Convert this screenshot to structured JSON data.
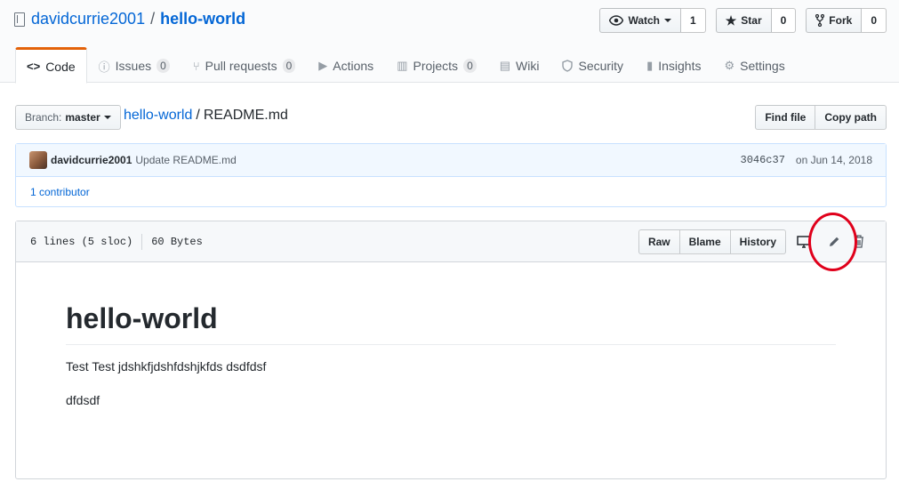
{
  "repo": {
    "owner": "davidcurrie2001",
    "name": "hello-world"
  },
  "actions": {
    "watch": {
      "label": "Watch",
      "count": "1"
    },
    "star": {
      "label": "Star",
      "count": "0"
    },
    "fork": {
      "label": "Fork",
      "count": "0"
    }
  },
  "tabs": [
    {
      "label": "Code",
      "icon": "code-icon"
    },
    {
      "label": "Issues",
      "count": "0",
      "icon": "issue-icon"
    },
    {
      "label": "Pull requests",
      "count": "0",
      "icon": "pull-request-icon"
    },
    {
      "label": "Actions",
      "icon": "play-icon"
    },
    {
      "label": "Projects",
      "count": "0",
      "icon": "project-icon"
    },
    {
      "label": "Wiki",
      "icon": "book-icon"
    },
    {
      "label": "Security",
      "icon": "shield-icon"
    },
    {
      "label": "Insights",
      "icon": "graph-icon"
    },
    {
      "label": "Settings",
      "icon": "gear-icon"
    }
  ],
  "branch": {
    "label": "Branch:",
    "value": "master"
  },
  "breadcrumb": {
    "repo": "hello-world",
    "separator": "/",
    "file": "README.md"
  },
  "file_buttons": {
    "find": "Find file",
    "copy": "Copy path"
  },
  "commit": {
    "author": "davidcurrie2001",
    "message": "Update README.md",
    "sha": "3046c37",
    "date": "on Jun 14, 2018",
    "contributors": "1 contributor"
  },
  "file": {
    "lines": "6 lines (5 sloc)",
    "size": "60 Bytes",
    "raw": "Raw",
    "blame": "Blame",
    "history": "History"
  },
  "readme": {
    "heading": "hello-world",
    "paragraphs": [
      "Test Test jdshkfjdshfdshjkfds dsdfdsf",
      "dfdsdf"
    ]
  },
  "colors": {
    "link": "#0366d6",
    "tab_accent": "#e36209",
    "annotation": "#e0001b"
  }
}
